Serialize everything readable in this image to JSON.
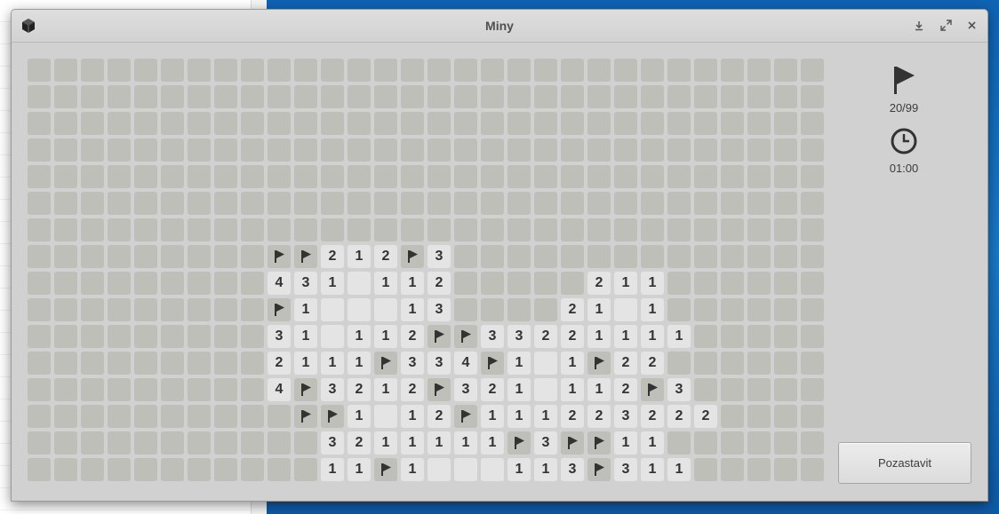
{
  "window": {
    "title": "Miny",
    "buttons": {
      "download_icon": "download-icon",
      "maximize_icon": "maximize-icon",
      "close_icon": "close-icon"
    }
  },
  "status": {
    "flags_label": "20/99",
    "time_label": "01:00"
  },
  "pause_button_label": "Pozastavit",
  "board": {
    "columns": 30,
    "rows": 16,
    "legend": "# = covered, F = flag, . = revealed empty, digit = revealed number",
    "grid": [
      "##############################",
      "##############################",
      "##############################",
      "##############################",
      "##############################",
      "##############################",
      "##############################",
      "#########FF212F3##############",
      "#########431.112#####211######",
      "#########F1...13####21.1######",
      "#########31.112FF33221111#####",
      "#########2111F334F1.1F22######",
      "#########4F3212F321.112F3#####",
      "##########FF1.12F111223222####",
      "###########3211111F3FF11######",
      "###########11F1...113F311#####"
    ]
  },
  "colors": {
    "covered": "#bdbfb8",
    "revealed": "#e4e4e4",
    "number": "#333333",
    "flag": "#333333"
  }
}
